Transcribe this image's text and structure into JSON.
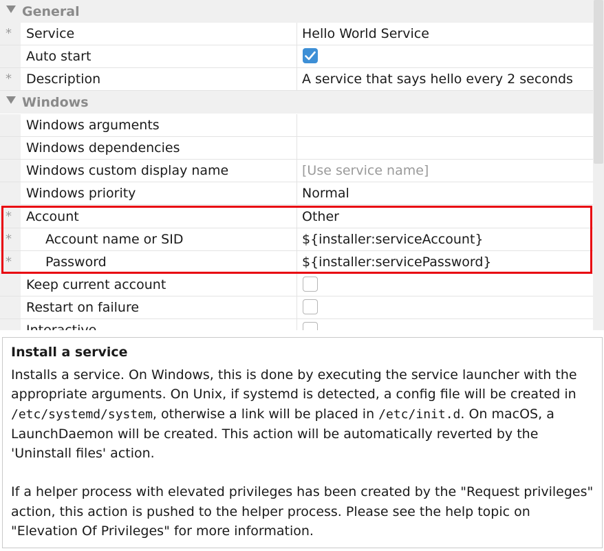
{
  "property_grid": {
    "categories": {
      "general": "General",
      "windows": "Windows"
    },
    "rows": {
      "service": {
        "name": "Service",
        "value": "Hello World Service",
        "required": true
      },
      "auto_start": {
        "name": "Auto start",
        "checked": true
      },
      "description": {
        "name": "Description",
        "value": "A service that says hello every 2 seconds",
        "required": true
      },
      "windows_arguments": {
        "name": "Windows arguments",
        "value": ""
      },
      "windows_dependencies": {
        "name": "Windows dependencies",
        "value": ""
      },
      "windows_custom_display_name": {
        "name": "Windows custom display name",
        "placeholder": "[Use service name]"
      },
      "windows_priority": {
        "name": "Windows priority",
        "value": "Normal"
      },
      "account": {
        "name": "Account",
        "value": "Other",
        "required": true
      },
      "account_name": {
        "name": "Account name or SID",
        "value": "${installer:serviceAccount}",
        "required": true
      },
      "password": {
        "name": "Password",
        "value": "${installer:servicePassword}",
        "required": true
      },
      "keep_current_account": {
        "name": "Keep current account",
        "checked": false
      },
      "restart_on_failure": {
        "name": "Restart on failure",
        "checked": false
      },
      "interactive": {
        "name": "Interactive",
        "checked": false
      }
    },
    "required_marker": "*"
  },
  "help": {
    "title": "Install a service",
    "p1_a": "Installs a service. On Windows, this is done by executing the service launcher with the appropriate arguments. On Unix, if systemd is detected, a config file will be created in ",
    "p1_path1": "/etc/systemd/system",
    "p1_b": ", otherwise a link will be placed in ",
    "p1_path2": "/etc/init.d",
    "p1_c": ". On macOS, a LaunchDaemon will be created. This action will be automatically reverted by the 'Uninstall files' action.",
    "p2": "If a helper process with elevated privileges has been created by the \"Request privileges\" action, this action is pushed to the helper process. Please see the help topic on \"Elevation Of Privileges\" for more information."
  },
  "colors": {
    "highlight": "#e8000d",
    "checkbox_checked": "#3d8fd6"
  },
  "icons": {
    "category_toggle": "triangle-down-icon",
    "checkmark": "checkmark-icon"
  }
}
